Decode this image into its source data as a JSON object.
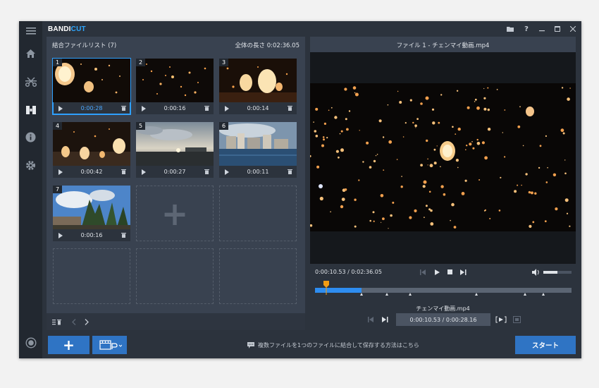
{
  "app": {
    "logo_main": "BANDI",
    "logo_accent": "CUT"
  },
  "titlebar_icons": [
    "folder-icon",
    "help-icon",
    "minimize-icon",
    "maximize-icon",
    "close-icon"
  ],
  "help_label": "?",
  "sidebar": {
    "items": [
      "menu-icon",
      "home-icon",
      "cut-icon",
      "join-icon",
      "info-icon",
      "settings-icon",
      "record-icon"
    ]
  },
  "filelist": {
    "title": "結合ファイルリスト (7)",
    "total_label": "全体の長さ 0:02:36.05",
    "clips": [
      {
        "num": "1",
        "duration": "0:00:28",
        "selected": true
      },
      {
        "num": "2",
        "duration": "0:00:16"
      },
      {
        "num": "3",
        "duration": "0:00:14"
      },
      {
        "num": "4",
        "duration": "0:00:42"
      },
      {
        "num": "5",
        "duration": "0:00:27"
      },
      {
        "num": "6",
        "duration": "0:00:11"
      },
      {
        "num": "7",
        "duration": "0:00:16"
      }
    ],
    "add_placeholder": "+"
  },
  "preview": {
    "title": "ファイル 1 - チェンマイ動画.mp4",
    "time": "0:00:10.53 / 0:02:36.05",
    "progress_fraction": 0.045,
    "segment_fraction": 0.18,
    "clip_name": "チェンマイ動画.mp4",
    "clip_time": "0:00:10.53 / 0:00:28.16",
    "volume_fraction": 0.5
  },
  "bottom": {
    "add_label": "+",
    "hint": "複数ファイルを1つのファイルに結合して保存する方法はこちら",
    "start_label": "スタート"
  }
}
